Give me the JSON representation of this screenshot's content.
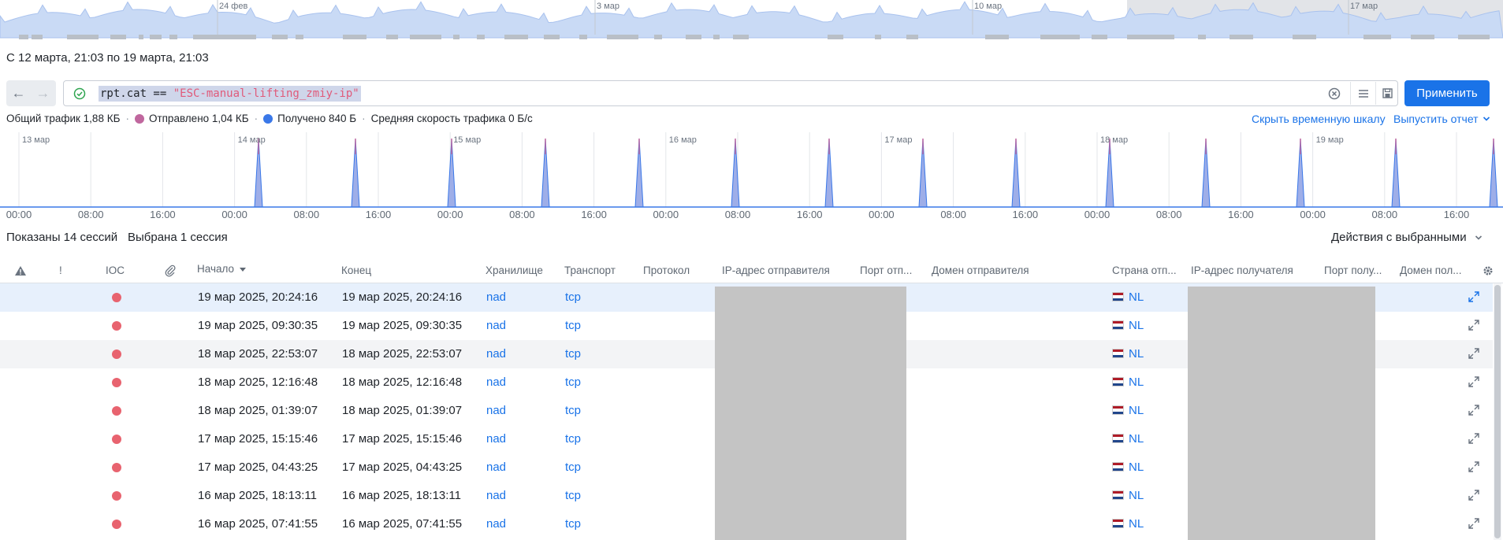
{
  "overview": {
    "labels": [
      "24 фев",
      "3 мар",
      "10 мар",
      "17 мар"
    ]
  },
  "period": "С 12 марта, 21:03 по 19 марта, 21:03",
  "query": {
    "key": "rpt.cat == ",
    "value": "\"ESC-manual-lifting_zmiy-ip\""
  },
  "apply_label": "Применить",
  "stats": {
    "total": "Общий трафик 1,88 КБ",
    "sent": "Отправлено 1,04 КБ",
    "received": "Получено 840 Б",
    "avg_speed": "Средняя скорость трафика 0 Б/с"
  },
  "hide_timeline": "Скрыть временную шкалу",
  "report": "Выпустить отчет",
  "timeline": {
    "day_labels": [
      "13 мар",
      "14 мар",
      "15 мар",
      "16 мар",
      "17 мар",
      "18 мар",
      "19 мар"
    ],
    "hour_labels": [
      "00:00",
      "08:00",
      "16:00",
      "00:00",
      "08:00",
      "16:00",
      "00:00",
      "08:00",
      "16:00",
      "00:00",
      "08:00",
      "16:00",
      "00:00",
      "08:00",
      "16:00",
      "00:00",
      "08:00",
      "16:00",
      "00:00",
      "08:00",
      "16:00"
    ]
  },
  "sessions_shown": "Показаны 14 сессий",
  "sessions_selected": "Выбрана 1 сессия",
  "actions": "Действия с выбранными",
  "columns": {
    "ioc": "IOC",
    "bang": "!",
    "start": "Начало",
    "end": "Конец",
    "storage": "Хранилище",
    "transport": "Транспорт",
    "protocol": "Протокол",
    "src_ip": "IP-адрес отправителя",
    "src_port": "Порт отп...",
    "src_domain": "Домен отправителя",
    "src_country": "Страна отп...",
    "dst_ip": "IP-адрес получателя",
    "dst_port": "Порт полу...",
    "dst_domain": "Домен пол..."
  },
  "rows": [
    {
      "start": "19 мар 2025, 20:24:16",
      "end": "19 мар 2025, 20:24:16",
      "storage": "nad",
      "transport": "tcp",
      "country": "NL"
    },
    {
      "start": "19 мар 2025, 09:30:35",
      "end": "19 мар 2025, 09:30:35",
      "storage": "nad",
      "transport": "tcp",
      "country": "NL"
    },
    {
      "start": "18 мар 2025, 22:53:07",
      "end": "18 мар 2025, 22:53:07",
      "storage": "nad",
      "transport": "tcp",
      "country": "NL"
    },
    {
      "start": "18 мар 2025, 12:16:48",
      "end": "18 мар 2025, 12:16:48",
      "storage": "nad",
      "transport": "tcp",
      "country": "NL"
    },
    {
      "start": "18 мар 2025, 01:39:07",
      "end": "18 мар 2025, 01:39:07",
      "storage": "nad",
      "transport": "tcp",
      "country": "NL"
    },
    {
      "start": "17 мар 2025, 15:15:46",
      "end": "17 мар 2025, 15:15:46",
      "storage": "nad",
      "transport": "tcp",
      "country": "NL"
    },
    {
      "start": "17 мар 2025, 04:43:25",
      "end": "17 мар 2025, 04:43:25",
      "storage": "nad",
      "transport": "tcp",
      "country": "NL"
    },
    {
      "start": "16 мар 2025, 18:13:11",
      "end": "16 мар 2025, 18:13:11",
      "storage": "nad",
      "transport": "tcp",
      "country": "NL"
    },
    {
      "start": "16 мар 2025, 07:41:55",
      "end": "16 мар 2025, 07:41:55",
      "storage": "nad",
      "transport": "tcp",
      "country": "NL"
    }
  ],
  "colors": {
    "accent": "#1a73e8",
    "sent": "#c0679e",
    "received": "#3a78e8",
    "ioc": "#e8636f",
    "selected_row": "#e7f0fc"
  }
}
